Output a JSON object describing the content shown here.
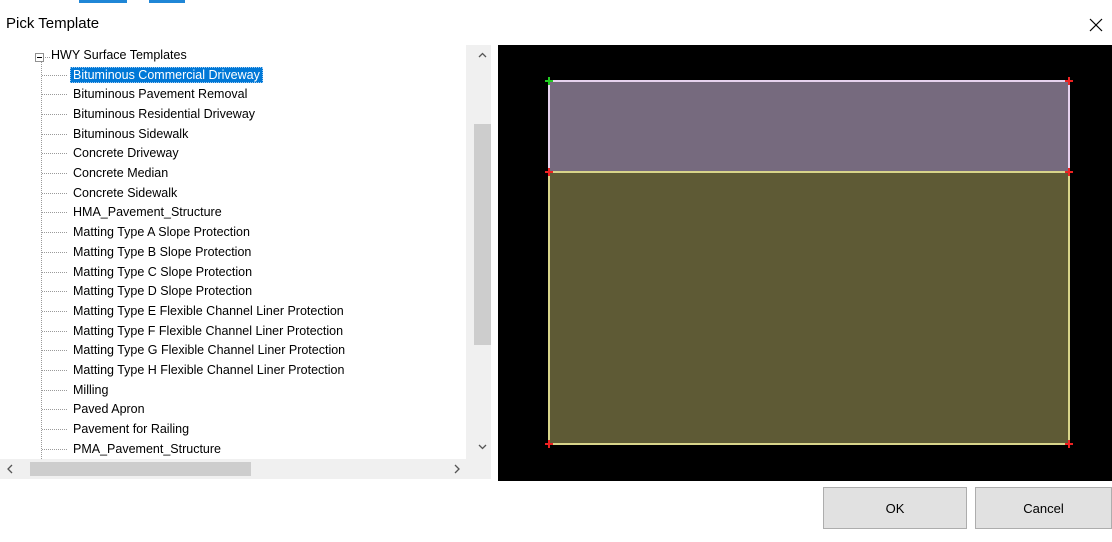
{
  "dialog": {
    "title": "Pick Template"
  },
  "tree": {
    "root_label": "HWY Surface Templates",
    "items": [
      {
        "label": "Bituminous Commercial Driveway",
        "selected": true
      },
      {
        "label": "Bituminous Pavement Removal"
      },
      {
        "label": "Bituminous Residential Driveway"
      },
      {
        "label": "Bituminous Sidewalk"
      },
      {
        "label": "Concrete Driveway"
      },
      {
        "label": "Concrete Median"
      },
      {
        "label": "Concrete Sidewalk"
      },
      {
        "label": "HMA_Pavement_Structure"
      },
      {
        "label": "Matting Type A Slope Protection"
      },
      {
        "label": "Matting Type B Slope Protection"
      },
      {
        "label": "Matting Type C Slope Protection"
      },
      {
        "label": "Matting Type D Slope Protection"
      },
      {
        "label": "Matting Type E Flexible Channel Liner Protection"
      },
      {
        "label": "Matting Type F Flexible Channel Liner Protection"
      },
      {
        "label": "Matting Type G Flexible Channel Liner Protection"
      },
      {
        "label": "Matting Type H Flexible Channel Liner Protection"
      },
      {
        "label": "Milling"
      },
      {
        "label": "Paved Apron"
      },
      {
        "label": "Pavement for Railing"
      },
      {
        "label": "PMA_Pavement_Structure"
      }
    ]
  },
  "preview": {
    "background_color": "#000000",
    "top_layer_color": "#766a7e",
    "bottom_layer_color": "#5e5a35",
    "top_outline_color": "#e6d2ee",
    "bottom_outline_color": "#d8d48a",
    "start_point_color": "#22cc22",
    "point_color": "#ee2222"
  },
  "buttons": {
    "ok_label": "OK",
    "cancel_label": "Cancel"
  },
  "colors": {
    "selection": "#0078d7",
    "title_accent": "#1f86d6"
  }
}
